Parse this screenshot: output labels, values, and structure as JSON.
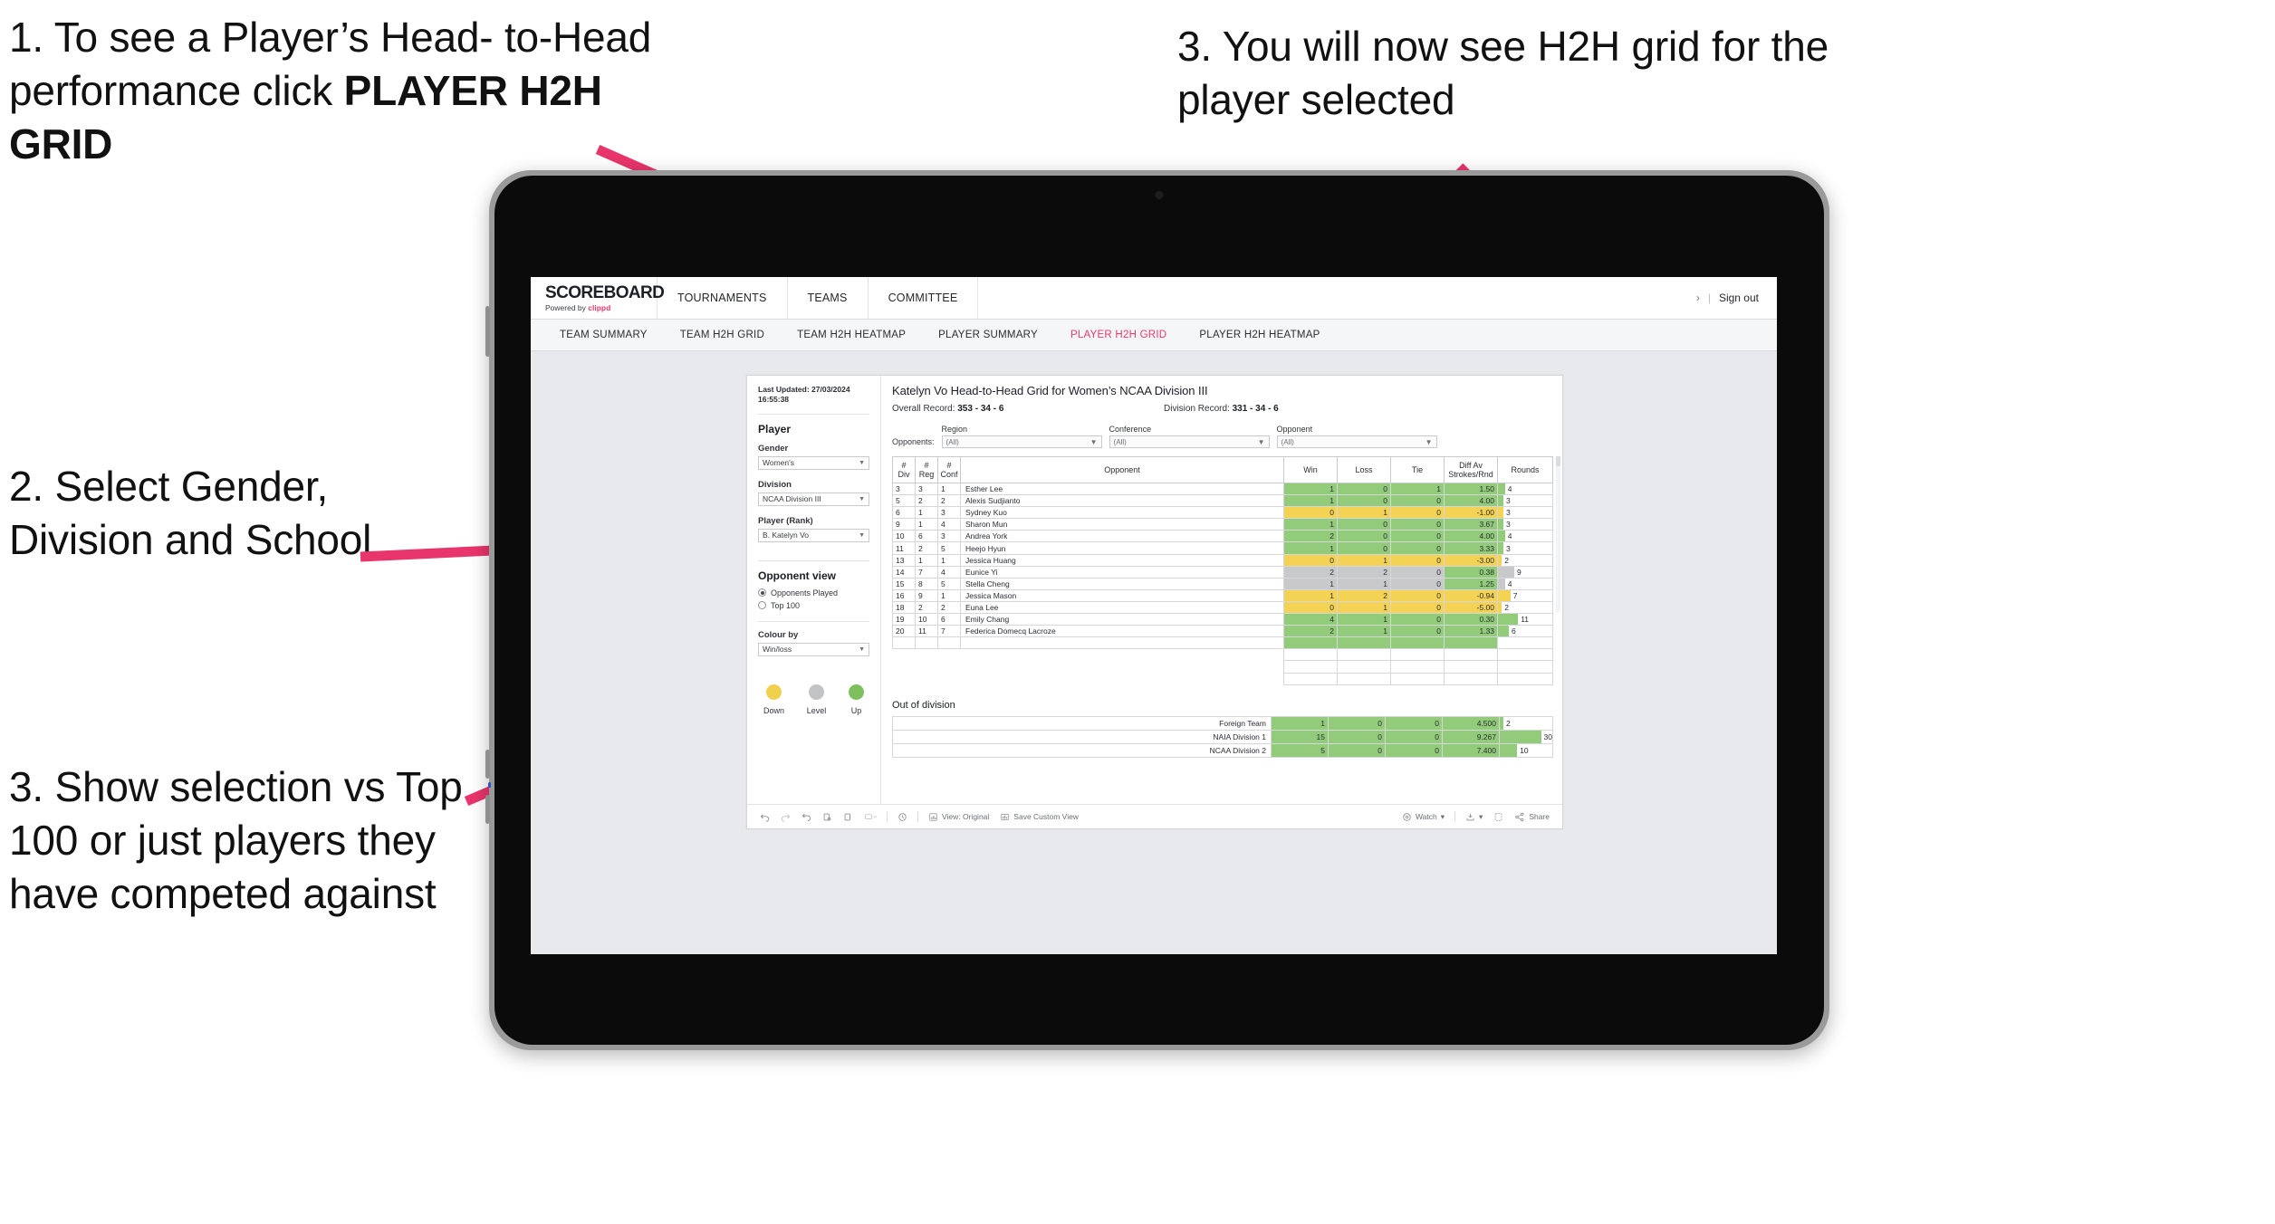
{
  "annotations": [
    {
      "id": "a1",
      "text_lines": [
        "1. To see a Player’s Head-",
        "to-Head performance click"
      ],
      "bold_line": "PLAYER H2H GRID"
    },
    {
      "id": "a2",
      "text": "2. Select Gender, Division and School"
    },
    {
      "id": "a3",
      "text": "3. Show selection vs Top 100 or just players they have competed against"
    },
    {
      "id": "a4",
      "text": "3. You will now see H2H grid for the player selected"
    }
  ],
  "colors": {
    "accent_pink": "#e8386a",
    "green": "#92cc7a",
    "yellow": "#f4d254",
    "grey": "#c8c9cb",
    "arrow": "#e8356b"
  },
  "app": {
    "brand": {
      "name": "SCOREBOARD",
      "powered_prefix": "Powered by ",
      "powered_name": "clippd"
    },
    "top_nav": [
      "TOURNAMENTS",
      "TEAMS",
      "COMMITTEE"
    ],
    "sign_out": {
      "chevron": "›",
      "divider": "|",
      "label": "Sign out"
    },
    "sub_nav": [
      {
        "label": "TEAM SUMMARY",
        "active": false
      },
      {
        "label": "TEAM H2H GRID",
        "active": false
      },
      {
        "label": "TEAM H2H HEATMAP",
        "active": false
      },
      {
        "label": "PLAYER SUMMARY",
        "active": false
      },
      {
        "label": "PLAYER H2H GRID",
        "active": true
      },
      {
        "label": "PLAYER H2H HEATMAP",
        "active": false
      }
    ]
  },
  "sidebar": {
    "last_updated_line1": "Last Updated: 27/03/2024",
    "last_updated_line2": "16:55:38",
    "player_heading": "Player",
    "gender": {
      "label": "Gender",
      "value": "Women's"
    },
    "division": {
      "label": "Division",
      "value": "NCAA Division III"
    },
    "player_rank": {
      "label": "Player (Rank)",
      "value": "B. Katelyn Vo"
    },
    "opponent_view": {
      "heading": "Opponent view",
      "options": [
        {
          "label": "Opponents Played",
          "selected": true
        },
        {
          "label": "Top 100",
          "selected": false
        }
      ]
    },
    "colour_by": {
      "label": "Colour by",
      "value": "Win/loss"
    },
    "legend": [
      {
        "caption": "Down",
        "color": "#f1d04e"
      },
      {
        "caption": "Level",
        "color": "#c2c3c5"
      },
      {
        "caption": "Up",
        "color": "#7fc05e"
      }
    ]
  },
  "main": {
    "title": "Katelyn Vo Head-to-Head Grid for Women’s NCAA Division III",
    "overall_record_label": "Overall Record:",
    "overall_record_value": "353 - 34 - 6",
    "division_record_label": "Division Record:",
    "division_record_value": "331 - 34 - 6",
    "opponents_label": "Opponents:",
    "filters": [
      {
        "label": "Region",
        "value": "(All)"
      },
      {
        "label": "Conference",
        "value": "(All)"
      },
      {
        "label": "Opponent",
        "value": "(All)"
      }
    ],
    "out_of_division_heading": "Out of division"
  },
  "chart_data": {
    "type": "table",
    "title": "Katelyn Vo Head-to-Head Grid for Women’s NCAA Division III",
    "columns": [
      "# Div",
      "# Reg",
      "# Conf",
      "Opponent",
      "Win",
      "Loss",
      "Tie",
      "Diff Av Strokes/Rnd",
      "Rounds"
    ],
    "column_header_lines": [
      [
        "#",
        "Div"
      ],
      [
        "#",
        "Reg"
      ],
      [
        "#",
        "Conf"
      ],
      [
        "Opponent"
      ],
      [
        "Win"
      ],
      [
        "Loss"
      ],
      [
        "Tie"
      ],
      [
        "Diff Av",
        "Strokes/Rnd"
      ],
      [
        "Rounds"
      ]
    ],
    "rounds_max": 30,
    "rows": [
      {
        "div": "3",
        "reg": "3",
        "conf": "1",
        "opponent": "Esther Lee",
        "win": "1",
        "loss": "0",
        "tie": "1",
        "diff": "1.50",
        "rounds": 4,
        "color": "green"
      },
      {
        "div": "5",
        "reg": "2",
        "conf": "2",
        "opponent": "Alexis Sudjianto",
        "win": "1",
        "loss": "0",
        "tie": "0",
        "diff": "4.00",
        "rounds": 3,
        "color": "green"
      },
      {
        "div": "6",
        "reg": "1",
        "conf": "3",
        "opponent": "Sydney Kuo",
        "win": "0",
        "loss": "1",
        "tie": "0",
        "diff": "-1.00",
        "rounds": 3,
        "color": "yellow"
      },
      {
        "div": "9",
        "reg": "1",
        "conf": "4",
        "opponent": "Sharon Mun",
        "win": "1",
        "loss": "0",
        "tie": "0",
        "diff": "3.67",
        "rounds": 3,
        "color": "green"
      },
      {
        "div": "10",
        "reg": "6",
        "conf": "3",
        "opponent": "Andrea York",
        "win": "2",
        "loss": "0",
        "tie": "0",
        "diff": "4.00",
        "rounds": 4,
        "color": "green"
      },
      {
        "div": "11",
        "reg": "2",
        "conf": "5",
        "opponent": "Heejo Hyun",
        "win": "1",
        "loss": "0",
        "tie": "0",
        "diff": "3.33",
        "rounds": 3,
        "color": "green"
      },
      {
        "div": "13",
        "reg": "1",
        "conf": "1",
        "opponent": "Jessica Huang",
        "win": "0",
        "loss": "1",
        "tie": "0",
        "diff": "-3.00",
        "rounds": 2,
        "color": "yellow"
      },
      {
        "div": "14",
        "reg": "7",
        "conf": "4",
        "opponent": "Eunice Yi",
        "win": "2",
        "loss": "2",
        "tie": "0",
        "diff": "0.38",
        "rounds": 9,
        "color": "grey",
        "diff_color": "green"
      },
      {
        "div": "15",
        "reg": "8",
        "conf": "5",
        "opponent": "Stella Cheng",
        "win": "1",
        "loss": "1",
        "tie": "0",
        "diff": "1.25",
        "rounds": 4,
        "color": "grey",
        "diff_color": "green"
      },
      {
        "div": "16",
        "reg": "9",
        "conf": "1",
        "opponent": "Jessica Mason",
        "win": "1",
        "loss": "2",
        "tie": "0",
        "diff": "-0.94",
        "rounds": 7,
        "color": "yellow"
      },
      {
        "div": "18",
        "reg": "2",
        "conf": "2",
        "opponent": "Euna Lee",
        "win": "0",
        "loss": "1",
        "tie": "0",
        "diff": "-5.00",
        "rounds": 2,
        "color": "yellow"
      },
      {
        "div": "19",
        "reg": "10",
        "conf": "6",
        "opponent": "Emily Chang",
        "win": "4",
        "loss": "1",
        "tie": "0",
        "diff": "0.30",
        "rounds": 11,
        "color": "green"
      },
      {
        "div": "20",
        "reg": "11",
        "conf": "7",
        "opponent": "Federica Domecq Lacroze",
        "win": "2",
        "loss": "1",
        "tie": "0",
        "diff": "1.33",
        "rounds": 6,
        "color": "green"
      }
    ],
    "out_of_division": {
      "rounds_max": 30,
      "rows": [
        {
          "label": "Foreign Team",
          "win": "1",
          "loss": "0",
          "tie": "0",
          "diff": "4.500",
          "rounds": 2,
          "color": "green"
        },
        {
          "label": "NAIA Division 1",
          "win": "15",
          "loss": "0",
          "tie": "0",
          "diff": "9.267",
          "rounds": 30,
          "color": "green"
        },
        {
          "label": "NCAA Division 2",
          "win": "5",
          "loss": "0",
          "tie": "0",
          "diff": "7.400",
          "rounds": 10,
          "color": "green"
        }
      ]
    }
  },
  "toolbar": {
    "undo": "undo-icon",
    "redo": "redo-icon",
    "revert": "revert-icon",
    "refresh": "refresh-icon",
    "pause": "pause-icon",
    "alerts": "alerts-icon",
    "view_label": "View: Original",
    "save_custom_view": "Save Custom View",
    "watch": "Watch",
    "share": "Share"
  }
}
